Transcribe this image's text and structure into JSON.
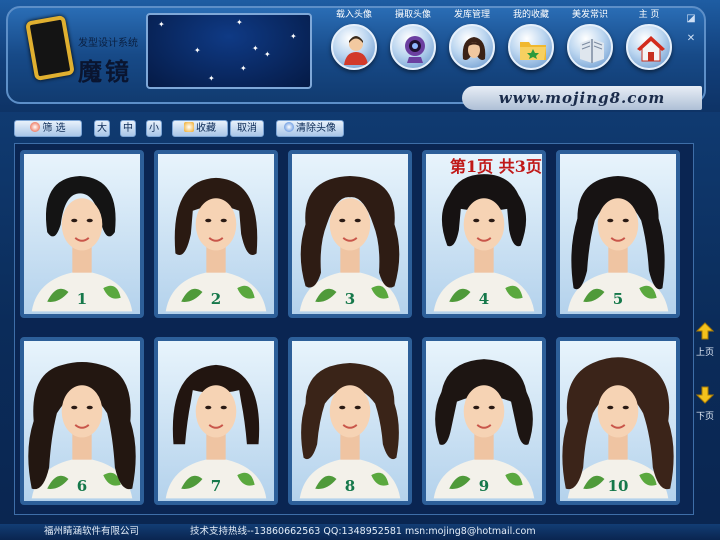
{
  "app": {
    "logo_subtitle": "发型设计系统",
    "logo_title": "魔镜",
    "website": "www.mojing8.com"
  },
  "nav": [
    {
      "label": "载入头像",
      "icon": "person-icon"
    },
    {
      "label": "摄取头像",
      "icon": "webcam-icon"
    },
    {
      "label": "发库管理",
      "icon": "hair-library-icon"
    },
    {
      "label": "我的收藏",
      "icon": "favorites-folder-icon"
    },
    {
      "label": "美发常识",
      "icon": "book-icon"
    },
    {
      "label": "主 页",
      "icon": "home-icon"
    }
  ],
  "window_controls": [
    "minimize-icon",
    "close-icon"
  ],
  "toolbar": {
    "filter": "筛 选",
    "size_large": "大",
    "size_medium": "中",
    "size_small": "小",
    "favorite": "收藏",
    "cancel": "取消",
    "clear_avatar": "清除头像"
  },
  "pagination": {
    "text": "第1页 共3页",
    "prev_label": "上页",
    "next_label": "下页"
  },
  "hairstyles": [
    {
      "number": "1",
      "style": "short-bob",
      "hair_color": "#141414"
    },
    {
      "number": "2",
      "style": "medium-bangs",
      "hair_color": "#2a1a12"
    },
    {
      "number": "3",
      "style": "long-wavy",
      "hair_color": "#2e1c14"
    },
    {
      "number": "4",
      "style": "short-shag",
      "hair_color": "#161212"
    },
    {
      "number": "5",
      "style": "long-layered",
      "hair_color": "#171313"
    },
    {
      "number": "6",
      "style": "long-curly",
      "hair_color": "#231711"
    },
    {
      "number": "7",
      "style": "straight-bob",
      "hair_color": "#221510"
    },
    {
      "number": "8",
      "style": "medium-wavy",
      "hair_color": "#3a2418"
    },
    {
      "number": "9",
      "style": "short-layered",
      "hair_color": "#1d1512"
    },
    {
      "number": "10",
      "style": "voluminous-curly",
      "hair_color": "#3b2419"
    }
  ],
  "status": {
    "company": "福州睛涵软件有限公司",
    "support": "技术支持热线--13860662563 QQ:1348952581 msn:mojing8@hotmail.com"
  }
}
